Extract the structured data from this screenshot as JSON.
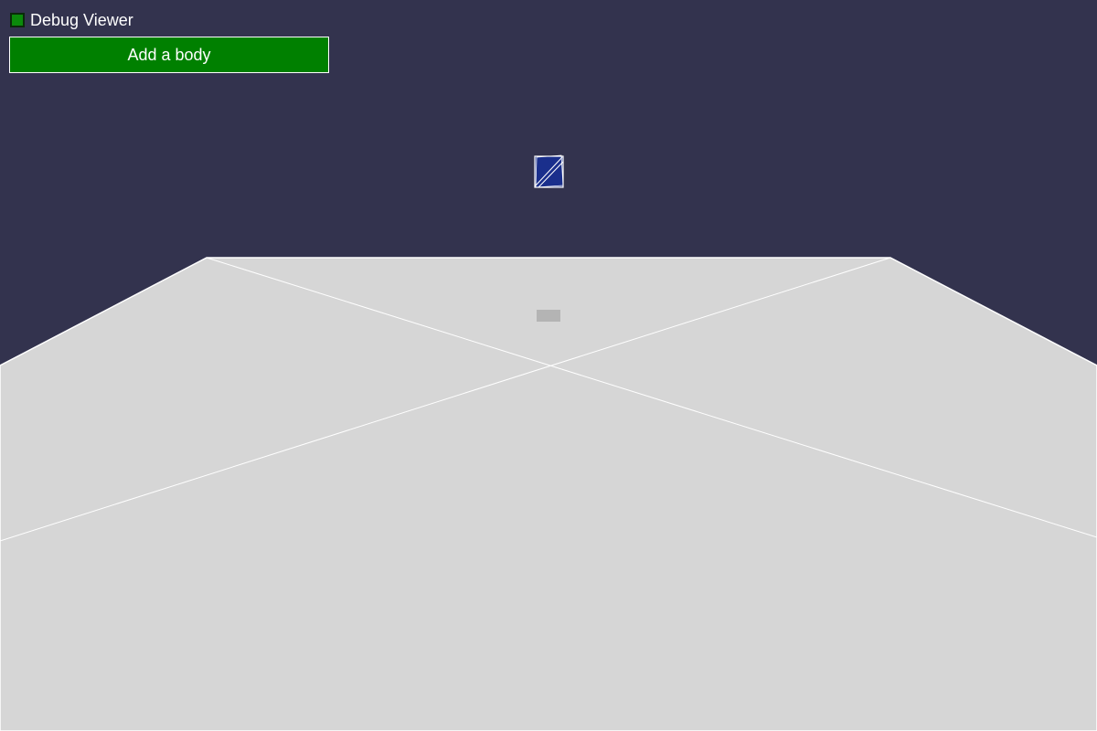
{
  "controls": {
    "debug_viewer_label": "Debug Viewer",
    "debug_viewer_checked": true,
    "add_body_label": "Add a body"
  },
  "colors": {
    "background": "#33334e",
    "floor": "#d6d6d6",
    "debug_lines": "#ffffff",
    "cube": "#1a2f8c",
    "cube_shadow": "#b0b0b0",
    "button": "#008000",
    "checkbox": "#0b8a0b"
  },
  "scene": {
    "objects": [
      "ground-plane",
      "falling-cube",
      "cube-shadow"
    ]
  }
}
